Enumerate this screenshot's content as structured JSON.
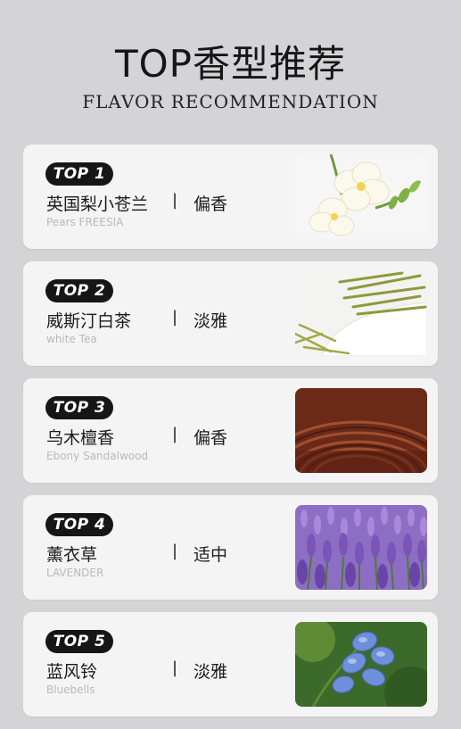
{
  "header": {
    "title": "TOP香型推荐",
    "subtitle": "FLAVOR RECOMMENDATION"
  },
  "items": [
    {
      "rank": "TOP 1",
      "name": "英国梨小苍兰",
      "separator": "|",
      "scent": "偏香",
      "english": "Pears FREESIA",
      "image": "freesia-flower"
    },
    {
      "rank": "TOP 2",
      "name": "威斯汀白茶",
      "separator": "|",
      "scent": "淡雅",
      "english": "white Tea",
      "image": "tea-leaves"
    },
    {
      "rank": "TOP 3",
      "name": "乌木檀香",
      "separator": "|",
      "scent": "偏香",
      "english": "Ebony Sandalwood",
      "image": "wood-grain"
    },
    {
      "rank": "TOP 4",
      "name": "薰衣草",
      "separator": "|",
      "scent": "适中",
      "english": "LAVENDER",
      "image": "lavender-field"
    },
    {
      "rank": "TOP 5",
      "name": "蓝风铃",
      "separator": "|",
      "scent": "淡雅",
      "english": "Bluebells",
      "image": "bluebell-flowers"
    }
  ]
}
